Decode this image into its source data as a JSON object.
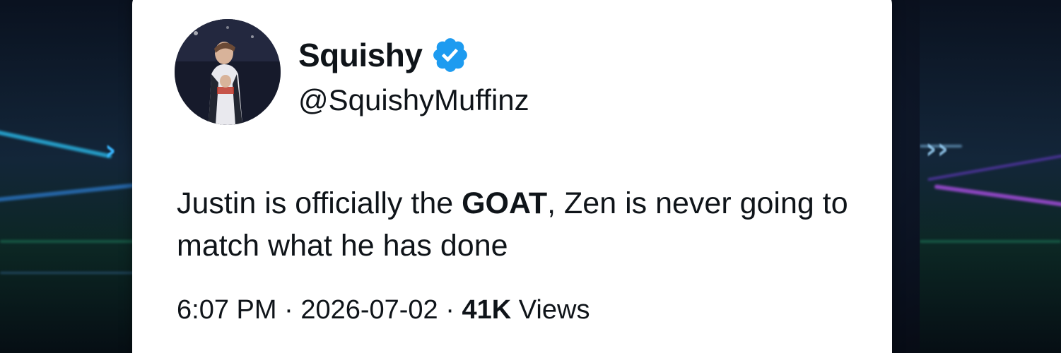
{
  "tweet": {
    "display_name": "Squishy",
    "handle": "@SquishyMuffinz",
    "verified": true,
    "text_part1": "Justin is officially the ",
    "text_bold": "GOAT",
    "text_part2": ", Zen is never going to match what he has done",
    "time": "6:07 PM",
    "separator": "·",
    "date": "2026-07-02",
    "views_count": "41K",
    "views_label": "Views"
  },
  "icons": {
    "verified": "verified-badge-icon"
  },
  "colors": {
    "verified_blue": "#1d9bf0",
    "text": "#0f1419",
    "card": "#ffffff"
  }
}
